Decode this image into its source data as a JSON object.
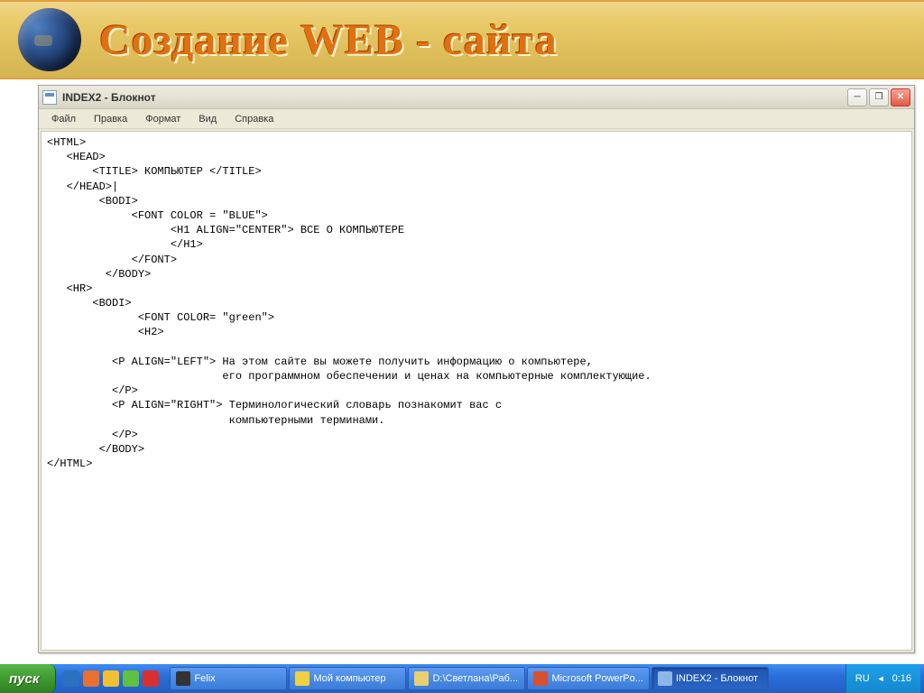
{
  "header": {
    "title": "Создание WEB - сайта"
  },
  "notepad": {
    "title": "INDEX2 - Блокнот",
    "menu": [
      "Файл",
      "Правка",
      "Формат",
      "Вид",
      "Справка"
    ],
    "lines": [
      "<HTML>",
      "   <HEAD>",
      "       <TITLE> КОМПЬЮТЕР </TITLE>",
      "   </HEAD>|",
      "        <BODI>",
      "             <FONT COLOR = \"BLUE\">",
      "                   <H1 ALIGN=\"CENTER\"> ВСЕ О КОМПЬЮТЕРЕ",
      "                   </H1>",
      "             </FONT>",
      "         </BODY>",
      "   <HR>",
      "       <BODI>",
      "              <FONT COLOR= \"green\">",
      "              <H2>",
      "",
      "          <P ALIGN=\"LEFT\"> На этом сайте вы можете получить информацию о компьютере,",
      "                           его программном обеспечении и ценах на компьютерные комплектующие.",
      "          </P>",
      "          <P ALIGN=\"RIGHT\"> Терминологический словарь познакомит вас с",
      "                            компьютерными терминами.",
      "          </P>",
      "        </BODY>",
      "</HTML>"
    ]
  },
  "taskbar": {
    "start": "пуск",
    "items": [
      {
        "label": "Felix",
        "color": "#333"
      },
      {
        "label": "Мой компьютер",
        "color": "#f0d040"
      },
      {
        "label": "D:\\Светлана\\Раб...",
        "color": "#e8d070"
      },
      {
        "label": "Microsoft PowerPo...",
        "color": "#d85030"
      },
      {
        "label": "INDEX2 - Блокнот",
        "color": "#8cb8e8",
        "active": true
      }
    ],
    "tray": {
      "lang": "RU",
      "time": "0:16"
    }
  },
  "colors": {
    "quick": [
      "#2c70c0",
      "#e87030",
      "#f0c030",
      "#60c040",
      "#d83030"
    ]
  }
}
